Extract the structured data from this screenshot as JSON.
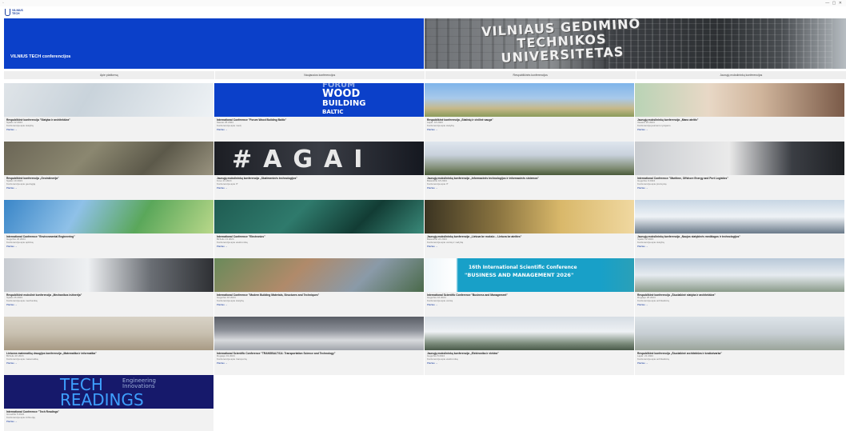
{
  "window": {
    "controls": "— ▢ ✕"
  },
  "logo": {
    "line1": "VILNIUS",
    "line2": "TECH"
  },
  "hero": {
    "title": "VILNIUS TECH conferencijos",
    "sign": "VILNIAUS GEDIMINO\nTECHNIKOS\nUNIVERSITETAS"
  },
  "tabs": [
    "Apie platformą",
    "Naujausios konferencijos",
    "Respublikinės konferencijos",
    "Jaunųjų mokslininkų konferencijos"
  ],
  "cards": [
    {
      "title": "Respublikinė konferencija \"Statyba ir architektūra\"",
      "date": "Spalio 12 2023",
      "mode": "Konferencija apie statybą",
      "more": "Plačiau →",
      "img": "architecture-photo"
    },
    {
      "title": "International Conference \"Forum Wood Building Baltic\"",
      "date": "Sausio 25 2024",
      "mode": "Konferencija apie medį",
      "more": "Plačiau →",
      "img": "forum-wood-banner",
      "img_text": [
        "FORUM",
        "WOOD",
        "BUILDING",
        "BALTIC"
      ]
    },
    {
      "title": "Respublikinė konferencija „Statinių ir civilinė sauga\"",
      "date": "Lapkr. 16 2023",
      "mode": "Konferencija apie statybą",
      "more": "Plačiau →",
      "img": "city-buildings-photo"
    },
    {
      "title": "Jaunųjų mokslininkų konferencija „Mano ateitis\"",
      "date": "Vasario 22 2024",
      "mode": "Konferencija jauniems tyrėjams",
      "more": "Plačiau →",
      "img": "students-photo"
    },
    {
      "title": "Respublikinė konferencija „Geoinžinerija\"",
      "date": "Spalio 19 2023",
      "mode": "Konferencija apie geologiją",
      "more": "Plačiau →",
      "img": "rock-photo"
    },
    {
      "title": "Jaunųjų mokslininkų konferencija „Skaitmeninės technologijos\"",
      "date": "Kovo 21 2024",
      "mode": "Konferencija apie IT",
      "more": "Plačiau →",
      "img": "agaj-banner",
      "img_text": [
        "#AGAI"
      ]
    },
    {
      "title": "Jaunųjų mokslininkų konferencija „Informacinės technologijos ir informacinės sistemos\"",
      "date": "Balandžio 18 2024",
      "mode": "Konferencija apie IT",
      "more": "Plačiau →",
      "img": "group-photo"
    },
    {
      "title": "International Conference \"Maritime, Offshore Energy and Port Logistics\"",
      "date": "Gegužės 9 2024",
      "mode": "Konferencija apie jūreivystę",
      "more": "Plačiau →",
      "img": "maritime-photo"
    },
    {
      "title": "International Conference \"Environmental Engineering\"",
      "date": "Gegužės 23 2024",
      "mode": "Konferencija apie aplinką",
      "more": "Plačiau →",
      "img": "environment-photo"
    },
    {
      "title": "International Conference \"Electronics\"",
      "date": "Birželio 13 2024",
      "mode": "Konferencija apie elektroniką",
      "more": "Plačiau →",
      "img": "electronics-photo"
    },
    {
      "title": "Jaunųjų mokslininkų konferencija „Lietuva be mokslo – Lietuva be ateities\"",
      "date": "Balandžio 24 2024",
      "mode": "Konferencija apie verslą ir vadybą",
      "more": "Plačiau →",
      "img": "finance-photo"
    },
    {
      "title": "Jaunųjų mokslininkų konferencija „Naujos statybinės medžiagos ir technologijos\"",
      "date": "Spalio 12 2023",
      "mode": "Konferencija apie statybą",
      "more": "Plačiau →",
      "img": "building-photo"
    },
    {
      "title": "Respublikinė mokslinė konferencija „Mechanikos inžinerija\"",
      "date": "Spalio 26 2023",
      "mode": "Konferencija apie mechaniką",
      "more": "Plačiau →",
      "img": "workshop-photo"
    },
    {
      "title": "International Conference \"Modern Building Materials, Structures and Techniques\"",
      "date": "Gegužės 16 2024",
      "mode": "Konferencija apie statybą",
      "more": "Plačiau →",
      "img": "aerial-city-photo"
    },
    {
      "title": "International Scientific Conference \"Business and Management\"",
      "date": "Gegužės 16 2024",
      "mode": "Konferencija apie verslą",
      "more": "Plačiau →",
      "img": "business-banner",
      "img_text": [
        "16th International Scientific Conference",
        "\"BUSINESS AND MANAGEMENT 2026\""
      ]
    },
    {
      "title": "Respublikinė konferencija „Šiuolaikinė statyba ir architektūra\"",
      "date": "Rugsėjo 25 2024",
      "mode": "Konferencija apie architektūrą",
      "more": "Plačiau →",
      "img": "modern-building-photo"
    },
    {
      "title": "Lietuvos matematikų draugijos konferencija „Matematika ir informatika\"",
      "date": "Birželio 20 2024",
      "mode": "Konferencija apie matematiką",
      "more": "Plačiau →",
      "img": "historic-building-photo"
    },
    {
      "title": "International Scientific Conference \"TRANSBALTICA: Transportation Science and Technology\"",
      "date": "Rugsėjo 19 2024",
      "mode": "Konferencija apie transportą",
      "more": "Plačiau →",
      "img": "car-photo"
    },
    {
      "title": "Jaunųjų mokslininkų konferencija „Elektronika ir elektra\"",
      "date": "Gegužės 8 2024",
      "mode": "Konferencija apie elektroniką",
      "more": "Plačiau →",
      "img": "team-photo"
    },
    {
      "title": "Respublikinė konferencija „Šiuolaikinė architektūra ir kraštotvarka\"",
      "date": "Lapkr. 21 2024",
      "mode": "Konferencija apie architektūrą",
      "more": "Plačiau →",
      "img": "landscape-photo"
    },
    {
      "title": "International Conference \"Tech Readings\"",
      "date": "Gruodžio 5 2024",
      "mode": "Konferencija apie inžineriją",
      "more": "Plačiau →",
      "img": "tech-readings-banner",
      "img_text": [
        "TECH",
        "READINGS",
        "Engineering",
        "Innovations"
      ]
    }
  ]
}
